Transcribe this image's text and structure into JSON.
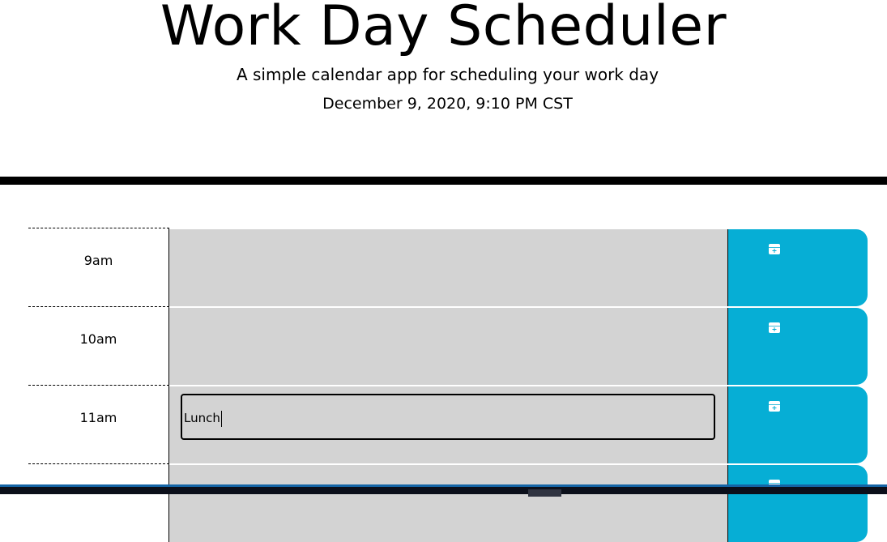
{
  "header": {
    "title": "Work Day Scheduler",
    "subtitle": "A simple calendar app for scheduling your work day",
    "date": "December 9, 2020, 9:10 PM CST"
  },
  "rows": [
    {
      "hour": "9am",
      "text": ""
    },
    {
      "hour": "10am",
      "text": ""
    },
    {
      "hour": "11am",
      "text": "Lunch"
    },
    {
      "hour": "",
      "text": ""
    }
  ],
  "colors": {
    "past": "#d3d3d3",
    "save": "#06aed5"
  },
  "icons": {
    "save": "calendar-plus-icon"
  }
}
